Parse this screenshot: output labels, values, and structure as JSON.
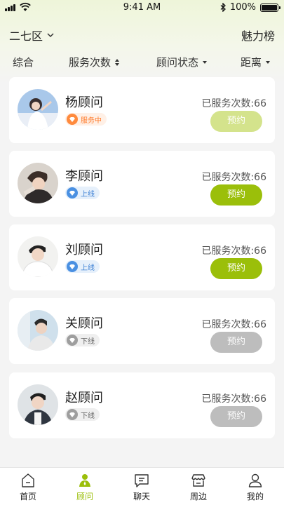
{
  "status_bar": {
    "time": "9:41 AM",
    "battery": "100%",
    "battery_level": 1.0,
    "icons": [
      "signal-icon",
      "wifi-icon",
      "bluetooth-icon",
      "battery-icon"
    ]
  },
  "header": {
    "city": "二七区",
    "ranking": "魅力榜"
  },
  "filters": [
    {
      "label": "综合"
    },
    {
      "label": "服务次数"
    },
    {
      "label": "顾问状态"
    },
    {
      "label": "距离"
    }
  ],
  "consultants": [
    {
      "name": "杨顾问",
      "status": "服务中",
      "count": "已服务次数:66",
      "book": "预约",
      "avatar": "girl-avatar"
    },
    {
      "name": "李顾问",
      "status": "上线",
      "count": "已服务次数:66",
      "book": "预约",
      "avatar": "boy-avatar"
    },
    {
      "name": "刘顾问",
      "status": "上线",
      "count": "已服务次数:66",
      "book": "预约",
      "avatar": "boy-avatar"
    },
    {
      "name": "关顾问",
      "status": "下线",
      "count": "已服务次数:66",
      "book": "预约",
      "avatar": "boy-avatar"
    },
    {
      "name": "赵顾问",
      "status": "下线",
      "count": "已服务次数:66",
      "book": "预约",
      "avatar": "boy-avatar"
    }
  ],
  "tabbar": [
    {
      "label": "首页",
      "icon": "home-icon"
    },
    {
      "label": "顾问",
      "icon": "consultant-icon",
      "active": true
    },
    {
      "label": "聊天",
      "icon": "chat-icon"
    },
    {
      "label": "周边",
      "icon": "store-icon"
    },
    {
      "label": "我的",
      "icon": "user-icon"
    }
  ],
  "colors": {
    "accent": "#9bbf0a",
    "accent_light": "#d4e38c",
    "disabled": "#bdbdbd",
    "busy_badge": "#ff8a3d",
    "online_badge": "#4a90e2",
    "offline_badge": "#9e9e9e"
  }
}
